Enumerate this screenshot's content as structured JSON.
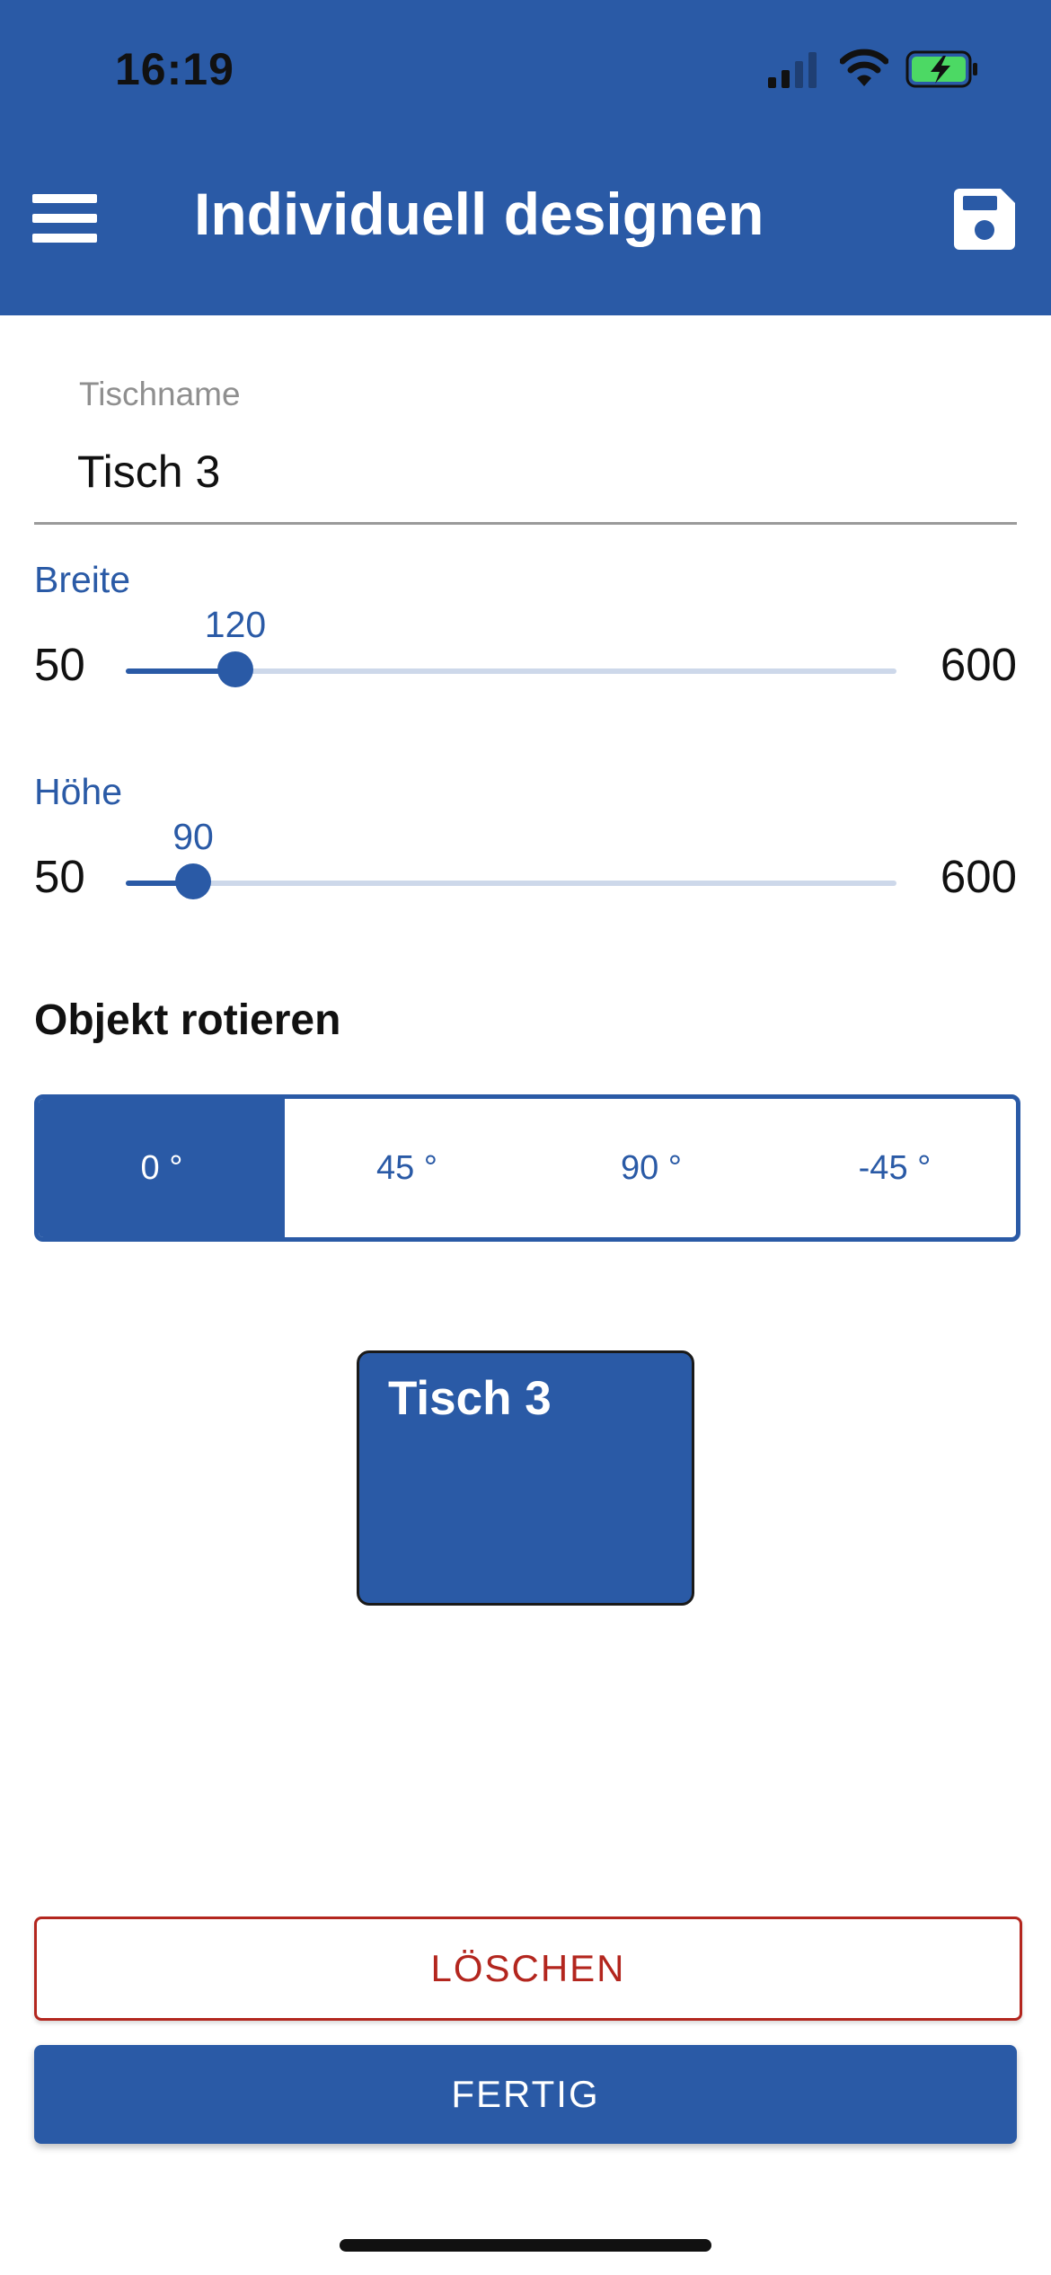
{
  "status_bar": {
    "time": "16:19"
  },
  "header": {
    "title": "Individuell designen",
    "menu_icon": "hamburger-menu-icon",
    "save_icon": "floppy-disk-icon"
  },
  "form": {
    "name_label": "Tischname",
    "name_value": "Tisch 3"
  },
  "sliders": {
    "breite": {
      "label": "Breite",
      "min": 50,
      "max": 600,
      "value": 120,
      "min_text": "50",
      "max_text": "600",
      "value_text": "120"
    },
    "hoehe": {
      "label": "Höhe",
      "min": 50,
      "max": 600,
      "value": 90,
      "min_text": "50",
      "max_text": "600",
      "value_text": "90"
    }
  },
  "rotation": {
    "title": "Objekt rotieren",
    "options": [
      "0 °",
      "45 °",
      "90 °",
      "-45 °"
    ],
    "selected_index": 0
  },
  "preview": {
    "table_name": "Tisch 3"
  },
  "actions": {
    "delete_label": "LÖSCHEN",
    "done_label": "FERTIG"
  },
  "colors": {
    "primary": "#2a5aa6",
    "danger": "#b3261e",
    "track": "#cdd8ea"
  }
}
